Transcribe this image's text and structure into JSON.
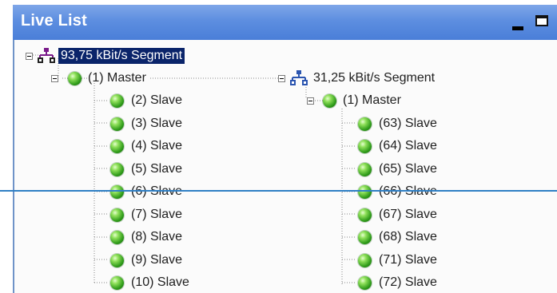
{
  "window": {
    "title": "Live List"
  },
  "tree": {
    "segment1": {
      "label": "93,75 kBit/s Segment",
      "master": "(1) Master",
      "slaves": [
        "(2) Slave",
        "(3) Slave",
        "(4) Slave",
        "(5) Slave",
        "(6) Slave",
        "(7) Slave",
        "(8) Slave",
        "(9) Slave",
        "(10) Slave"
      ]
    },
    "segment2": {
      "label": "31,25 kBit/s Segment",
      "master": "(1) Master",
      "slaves": [
        "(63) Slave",
        "(64) Slave",
        "(65) Slave",
        "(66) Slave",
        "(67) Slave",
        "(68) Slave",
        "(71) Slave",
        "(72) Slave"
      ]
    }
  },
  "icons": {
    "segment": "network-icon",
    "device": "green-ball-icon",
    "collapse": "minus-box-icon"
  },
  "colors": {
    "titlebar": "#5d8ee0",
    "selection": "#0a246a",
    "status_ok": "#2f9b1a",
    "segment_icon": "#7a1a8a"
  }
}
